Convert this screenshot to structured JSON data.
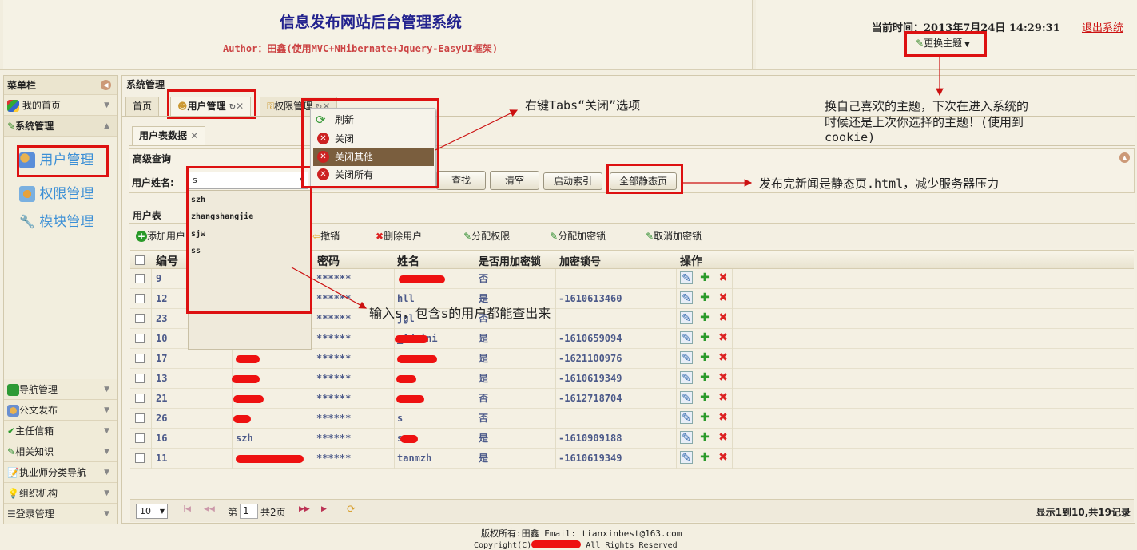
{
  "header": {
    "title": "信息发布网站后台管理系统",
    "author": "Author：田鑫(使用MVC+NHibernate+Jquery-EasyUI框架)",
    "time_label": "当前时间：",
    "time_value": "2013年7月24日 14:29:31",
    "logout": "退出系统",
    "theme_button": "更换主题"
  },
  "sidebar": {
    "title": "菜单栏",
    "home": "我的首页",
    "system_mgmt": "系统管理",
    "sub_items": [
      "用户管理",
      "权限管理",
      "模块管理"
    ],
    "bottom_items": [
      "导航管理",
      "公文发布",
      "主任信箱",
      "相关知识",
      "执业师分类导航",
      "组织机构",
      "登录管理"
    ]
  },
  "main": {
    "panel_title": "系统管理",
    "tabs": [
      "首页",
      "用户管理",
      "权限管理"
    ],
    "sub_tab": "用户表数据",
    "search_title": "高级查询",
    "search_label": "用户姓名:",
    "search_value": "s",
    "autocomplete": [
      "szh",
      "zhangshangjie",
      "sjw",
      "ss"
    ],
    "buttons": {
      "find": "查找",
      "clear": "清空",
      "index": "启动索引",
      "static": "全部静态页"
    },
    "table_title": "用户表",
    "toolbar": [
      "添加用户",
      "撤销",
      "删除用户",
      "分配权限",
      "分配加密锁",
      "取消加密锁"
    ]
  },
  "context_menu": [
    "刷新",
    "关闭",
    "关闭其他",
    "关闭所有"
  ],
  "table": {
    "columns": [
      "编号",
      "密码",
      "姓名",
      "是否用加密锁",
      "加密锁号",
      "操作"
    ],
    "rows": [
      {
        "id": "9",
        "pwd": "******",
        "name": "",
        "lock": "否",
        "lock_no": ""
      },
      {
        "id": "12",
        "pwd": "******",
        "name": "hll",
        "lock": "是",
        "lock_no": "-1610613460"
      },
      {
        "id": "23",
        "pwd": "******",
        "name": "jgl",
        "lock": "否",
        "lock_no": ""
      },
      {
        "id": "10",
        "pwd": "******",
        "name": "_Admini",
        "lock": "是",
        "lock_no": "-1610659094"
      },
      {
        "id": "17",
        "pwd": "******",
        "name": "",
        "lock": "是",
        "lock_no": "-1621100976"
      },
      {
        "id": "13",
        "pwd": "******",
        "name": "",
        "lock": "是",
        "lock_no": "-1610619349"
      },
      {
        "id": "21",
        "pwd": "******",
        "name": "",
        "lock": "否",
        "lock_no": "-1612718704"
      },
      {
        "id": "26",
        "pwd": "******",
        "name": "s",
        "lock": "否",
        "lock_no": ""
      },
      {
        "id": "16",
        "login": "szh",
        "pwd": "******",
        "name": "s",
        "lock": "是",
        "lock_no": "-1610909188"
      },
      {
        "id": "11",
        "pwd": "******",
        "name": "tanmzh",
        "lock": "是",
        "lock_no": "-1610619349"
      }
    ]
  },
  "pager": {
    "page_size": "10",
    "page_label": "第",
    "page_value": "1",
    "page_total": "共2页",
    "summary": "显示1到10,共19记录"
  },
  "annotations": {
    "tabs_close": "右键Tabs“关闭”选项",
    "theme_1": "换自己喜欢的主题，下次在进入系统的",
    "theme_2": "时候还是上次你选择的主题！(使用到",
    "theme_3": "cookie)",
    "static": "发布完新闻是静态页.html，减少服务器压力",
    "search": "输入s，包含s的用户都能查出来"
  },
  "footer": {
    "line1": "版权所有:田鑫 Email: tianxinbest@163.com",
    "line2_left": "Copyright(C)",
    "line2_right": "All Rights Reserved"
  }
}
